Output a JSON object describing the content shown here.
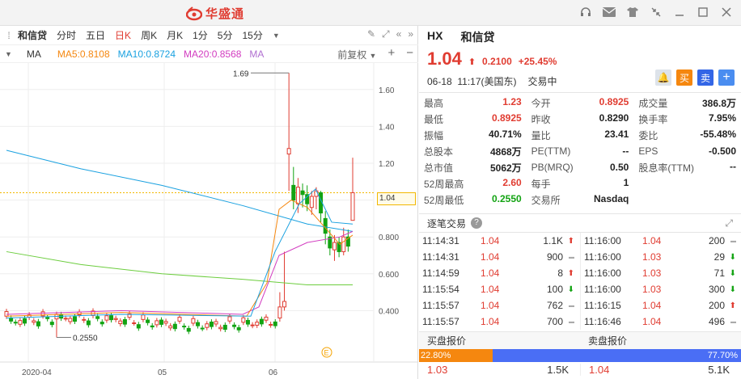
{
  "app": {
    "logo_text": "华盛通"
  },
  "toolbar": {
    "stock_name": "和信贷",
    "periods": [
      "分时",
      "五日",
      "日K",
      "周K",
      "月K",
      "1分",
      "5分",
      "15分"
    ],
    "active_period": "日K"
  },
  "ma": {
    "label": "MA",
    "ma5": "MA5:0.8108",
    "ma10": "MA10:0.8724",
    "ma20": "MA20:0.8568",
    "ma_more": "MA",
    "adjust": "前复权",
    "colors": {
      "ma5": "#f5870f",
      "ma10": "#1aa1e0",
      "ma20": "#d23cc0",
      "ma60": "#6ccd3e"
    }
  },
  "chart_data": {
    "type": "candlestick",
    "y_ticks": [
      "1.60",
      "1.40",
      "1.20",
      "1.00",
      "0.800",
      "0.600",
      "0.400"
    ],
    "x_ticks": [
      "2020-04",
      "05",
      "06"
    ],
    "ylim": [
      0.2,
      1.7
    ],
    "high_label": "1.69",
    "low_label": "0.2550",
    "last_price_label": "1.04",
    "marker": "E"
  },
  "quote": {
    "symbol": "HX",
    "name": "和信贷",
    "price": "1.04",
    "change": "0.2100",
    "change_pct": "+25.45%",
    "date": "06-18",
    "time": "11:17(美国东)",
    "status": "交易中",
    "buy_label": "买",
    "sell_label": "卖"
  },
  "stats": [
    [
      {
        "l": "最高",
        "v": "1.23",
        "c": "red"
      },
      {
        "l": "今开",
        "v": "0.8925",
        "c": "red"
      },
      {
        "l": "成交量",
        "v": "386.8万",
        "c": ""
      }
    ],
    [
      {
        "l": "最低",
        "v": "0.8925",
        "c": "red"
      },
      {
        "l": "昨收",
        "v": "0.8290",
        "c": ""
      },
      {
        "l": "换手率",
        "v": "7.95%",
        "c": ""
      }
    ],
    [
      {
        "l": "振幅",
        "v": "40.71%",
        "c": ""
      },
      {
        "l": "量比",
        "v": "23.41",
        "c": ""
      },
      {
        "l": "委比",
        "v": "-55.48%",
        "c": ""
      }
    ],
    [
      {
        "l": "总股本",
        "v": "4868万",
        "c": ""
      },
      {
        "l": "PE(TTM)",
        "v": "--",
        "c": ""
      },
      {
        "l": "EPS",
        "v": "-0.500",
        "c": ""
      }
    ],
    [
      {
        "l": "总市值",
        "v": "5062万",
        "c": ""
      },
      {
        "l": "PB(MRQ)",
        "v": "0.50",
        "c": ""
      },
      {
        "l": "股息率(TTM)",
        "v": "--",
        "c": ""
      }
    ],
    [
      {
        "l": "52周最高",
        "v": "2.60",
        "c": "red"
      },
      {
        "l": "每手",
        "v": "1",
        "c": ""
      },
      {
        "l": "",
        "v": "",
        "c": ""
      }
    ],
    [
      {
        "l": "52周最低",
        "v": "0.2550",
        "c": "green"
      },
      {
        "l": "交易所",
        "v": "Nasdaq",
        "c": ""
      },
      {
        "l": "",
        "v": "",
        "c": ""
      }
    ]
  ],
  "trades": {
    "title": "逐笔交易",
    "left": [
      {
        "t": "11:14:31",
        "p": "1.04",
        "v": "1.1K",
        "d": "up"
      },
      {
        "t": "11:14:31",
        "p": "1.04",
        "v": "900",
        "d": "flat"
      },
      {
        "t": "11:14:59",
        "p": "1.04",
        "v": "8",
        "d": "up"
      },
      {
        "t": "11:15:54",
        "p": "1.04",
        "v": "100",
        "d": "down"
      },
      {
        "t": "11:15:57",
        "p": "1.04",
        "v": "762",
        "d": "flat"
      },
      {
        "t": "11:15:57",
        "p": "1.04",
        "v": "700",
        "d": "flat"
      }
    ],
    "right": [
      {
        "t": "11:16:00",
        "p": "1.04",
        "v": "200",
        "d": "flat"
      },
      {
        "t": "11:16:00",
        "p": "1.03",
        "v": "29",
        "d": "down"
      },
      {
        "t": "11:16:00",
        "p": "1.03",
        "v": "71",
        "d": "down"
      },
      {
        "t": "11:16:00",
        "p": "1.03",
        "v": "300",
        "d": "down"
      },
      {
        "t": "11:16:15",
        "p": "1.04",
        "v": "200",
        "d": "up"
      },
      {
        "t": "11:16:46",
        "p": "1.04",
        "v": "496",
        "d": "flat"
      }
    ]
  },
  "book": {
    "buy_title": "买盘报价",
    "sell_title": "卖盘报价",
    "buy_pct": "22.80%",
    "sell_pct": "77.70%",
    "buy_fraction": 0.228,
    "bid_price": "1.03",
    "bid_size": "1.5K",
    "ask_price": "1.04",
    "ask_size": "5.1K"
  }
}
